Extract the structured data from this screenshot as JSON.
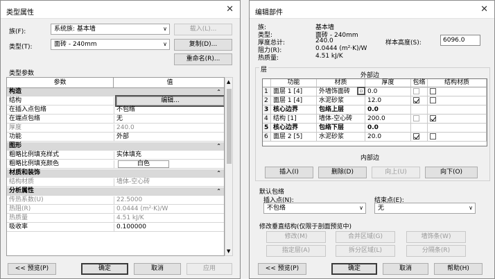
{
  "type_props": {
    "title": "类型属性",
    "family_label": "族(F):",
    "family_value": "系统族: 基本墙",
    "type_label": "类型(T):",
    "type_value": "面砖 - 240mm",
    "load_button": "载入(L)...",
    "duplicate_button": "复制(D)...",
    "rename_button": "重命名(R)...",
    "params_heading": "类型参数",
    "col_param": "参数",
    "col_value": "值",
    "rows": [
      {
        "kind": "group",
        "name": "构造"
      },
      {
        "kind": "row",
        "name": "结构",
        "value": "编辑...",
        "button": true
      },
      {
        "kind": "row",
        "name": "在插入点包络",
        "value": "不包络"
      },
      {
        "kind": "row",
        "name": "在端点包络",
        "value": "无"
      },
      {
        "kind": "row",
        "name": "厚度",
        "value": "240.0",
        "dim": true
      },
      {
        "kind": "row",
        "name": "功能",
        "value": "外部"
      },
      {
        "kind": "group",
        "name": "图形"
      },
      {
        "kind": "row",
        "name": "粗略比例填充样式",
        "value": "实体填充"
      },
      {
        "kind": "row",
        "name": "粗略比例填充颜色",
        "value": "白色",
        "swatch": true
      },
      {
        "kind": "group",
        "name": "材质和装饰"
      },
      {
        "kind": "row",
        "name": "结构材质",
        "value": "墙体-空心砖",
        "dim": true
      },
      {
        "kind": "group",
        "name": "分析属性"
      },
      {
        "kind": "row",
        "name": "传热系数(U)",
        "value": "22.5000",
        "dim": true
      },
      {
        "kind": "row",
        "name": "热阻(R)",
        "value": "0.0444 (m²·K)/W",
        "dim": true
      },
      {
        "kind": "row",
        "name": "热质量",
        "value": "4.51 kJ/K",
        "dim": true
      },
      {
        "kind": "row",
        "name": "吸收率",
        "value": "0.100000"
      }
    ],
    "preview_button": "<< 预览(P)",
    "ok_button": "确定",
    "cancel_button": "取消",
    "apply_button": "应用"
  },
  "edit_assembly": {
    "title": "编辑部件",
    "info": [
      {
        "label": "族:",
        "value": "基本墙"
      },
      {
        "label": "类型:",
        "value": "面砖 - 240mm"
      },
      {
        "label": "厚度总计:",
        "value": "240.0"
      },
      {
        "label": "阻力(R):",
        "value": "0.0444 (m²·K)/W"
      },
      {
        "label": "热质量:",
        "value": "4.51 kJ/K"
      }
    ],
    "sample_height_label": "样本高度(S):",
    "sample_height_value": "6096.0",
    "layers_group": "层",
    "exterior_side": "外部边",
    "interior_side": "内部边",
    "columns": [
      "功能",
      "材质",
      "厚度",
      "包络",
      "结构材质"
    ],
    "layers": [
      {
        "num": "1",
        "function": "面层 1 [4]",
        "material": "外墙饰面砖",
        "thickness": "0.0",
        "wrap": false,
        "struct": false,
        "core": false
      },
      {
        "num": "2",
        "function": "面层 1 [4]",
        "material": "水泥砂浆",
        "thickness": "12.0",
        "wrap": true,
        "struct": false,
        "core": false
      },
      {
        "num": "3",
        "function": "核心边界",
        "material": "包络上层",
        "thickness": "0.0",
        "core": true
      },
      {
        "num": "4",
        "function": "结构 [1]",
        "material": "墙体-空心砖",
        "thickness": "200.0",
        "wrap": false,
        "struct": true,
        "core": false
      },
      {
        "num": "5",
        "function": "核心边界",
        "material": "包络下层",
        "thickness": "0.0",
        "core": true
      },
      {
        "num": "6",
        "function": "面层 2 [5]",
        "material": "水泥砂浆",
        "thickness": "20.0",
        "wrap": true,
        "struct": false,
        "core": false
      }
    ],
    "insert_button": "插入(I)",
    "delete_button": "删除(D)",
    "up_button": "向上(U)",
    "down_button": "向下(O)",
    "default_wrap_heading": "默认包络",
    "insert_point_label": "插入点(N):",
    "insert_point_value": "不包络",
    "end_point_label": "结束点(E):",
    "end_point_value": "无",
    "modify_heading": "修改垂直结构(仅限于剖面预览中)",
    "modify_button": "修改(M)",
    "merge_button": "合并区域(G)",
    "wall_sweep_button": "墙饰条(W)",
    "assign_layer_button": "指定层(A)",
    "split_button": "拆分区域(L)",
    "reveal_button": "分隔条(R)",
    "preview_button": "<< 预览(P)",
    "ok_button": "确定",
    "cancel_button": "取消",
    "help_button": "帮助(H)"
  },
  "icons": {
    "close": "close-icon",
    "dropdown": "chevron-down-icon",
    "collapse": "collapse-chevron-icon"
  },
  "colors": {
    "highlight_frame": "#555555",
    "group_row": "#d9d9d9"
  }
}
